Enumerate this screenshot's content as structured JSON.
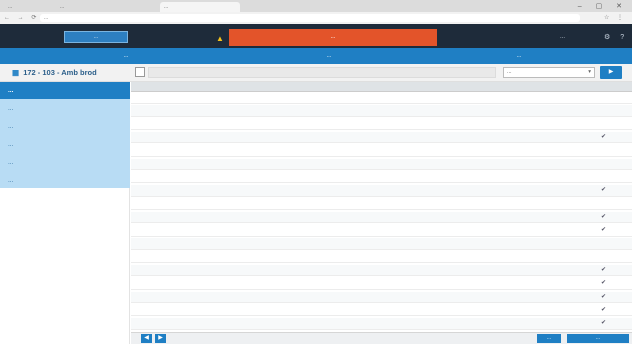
{
  "browser": {
    "tabs": [
      "...",
      "...",
      "...",
      ""
    ],
    "url": "...",
    "nav_icons": "← → ⟳",
    "right_icons": "☆ ⋮",
    "window_controls": "– ▢ ✕"
  },
  "header": {
    "logo_text": "...",
    "alert_text": "...",
    "user_text": "...",
    "icons": "⚙ ?"
  },
  "nav": {
    "tabs": [
      "...",
      "...",
      "..."
    ]
  },
  "breadcrumb": {
    "icon": "▦",
    "text": "172 - 103 - Amb brod"
  },
  "toolbar": {
    "filter_placeholder": "",
    "select_value": "...",
    "go_label": "▶"
  },
  "sidebar": {
    "items": [
      {
        "label": "...",
        "active": true
      },
      {
        "label": "...",
        "active": false
      },
      {
        "label": "...",
        "active": false
      },
      {
        "label": "...",
        "active": false
      },
      {
        "label": "...",
        "active": false
      },
      {
        "label": "...",
        "active": false
      }
    ]
  },
  "table": {
    "columns": [
      "",
      "",
      "",
      "",
      "",
      "",
      "",
      ""
    ],
    "rows": [
      [
        "",
        "",
        "",
        "",
        "",
        "",
        "",
        ""
      ],
      [
        "",
        "",
        "",
        "",
        "",
        "",
        "",
        ""
      ],
      [
        "",
        "",
        "",
        "",
        "",
        "",
        "",
        ""
      ],
      [
        "",
        "",
        "",
        "",
        "",
        "",
        "",
        "✔"
      ],
      [
        "",
        "",
        "",
        "",
        "",
        "",
        "",
        ""
      ],
      [
        "",
        "",
        "",
        "",
        "",
        "",
        "",
        ""
      ],
      [
        "",
        "",
        "",
        "",
        "",
        "",
        "",
        ""
      ],
      [
        "",
        "",
        "",
        "",
        "",
        "",
        "",
        "✔"
      ],
      [
        "",
        "",
        "",
        "",
        "",
        "",
        "",
        ""
      ],
      [
        "",
        "",
        "",
        "",
        "",
        "",
        "",
        "✔"
      ],
      [
        "",
        "",
        "",
        "",
        "",
        "",
        "",
        "✔"
      ],
      [
        "",
        "",
        "",
        "",
        "",
        "",
        "",
        ""
      ],
      [
        "",
        "",
        "",
        "",
        "",
        "",
        "",
        ""
      ],
      [
        "",
        "",
        "",
        "",
        "",
        "",
        "",
        "✔"
      ],
      [
        "",
        "",
        "",
        "",
        "",
        "",
        "",
        "✔"
      ],
      [
        "",
        "",
        "",
        "",
        "",
        "",
        "",
        "✔"
      ],
      [
        "",
        "",
        "",
        "",
        "",
        "",
        "",
        "✔"
      ],
      [
        "",
        "",
        "",
        "",
        "",
        "",
        "",
        "✔"
      ]
    ]
  },
  "footer": {
    "prev": "◀",
    "next": "▶",
    "btn1": "...",
    "btn2": "..."
  },
  "colors": {
    "primary": "#1f7fc4",
    "topbar": "#1e2b3a",
    "alert": "#e3542a",
    "sidebar_bg": "#b8dcf4"
  }
}
